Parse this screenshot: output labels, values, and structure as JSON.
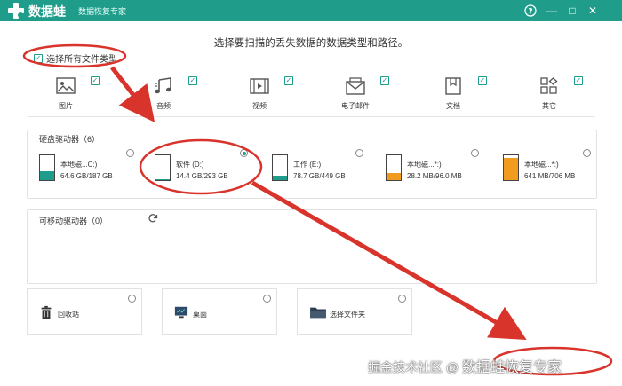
{
  "app": {
    "name": "数据蛙",
    "subtitle": "数据恢复专家"
  },
  "window_buttons": {
    "help": "?",
    "minimize": "—",
    "maximize": "□",
    "close": "✕"
  },
  "instruction": "选择要扫描的丢失数据的数据类型和路径。",
  "select_all_label": "选择所有文件类型",
  "file_types": [
    {
      "label": "图片",
      "icon": "image-icon",
      "checked": true
    },
    {
      "label": "音频",
      "icon": "music-icon",
      "checked": true
    },
    {
      "label": "视频",
      "icon": "video-icon",
      "checked": true
    },
    {
      "label": "电子邮件",
      "icon": "email-icon",
      "checked": true
    },
    {
      "label": "文档",
      "icon": "document-icon",
      "checked": true
    },
    {
      "label": "其它",
      "icon": "other-icon",
      "checked": true
    }
  ],
  "hard_drives": {
    "title": "硬盘驱动器（6）",
    "items": [
      {
        "name": "本地磁...C:)",
        "size": "64.6 GB/187 GB",
        "fill_color": "#1f9d8a",
        "fill_fraction": 0.35,
        "selected": false
      },
      {
        "name": "软件 (D:)",
        "size": "14.4 GB/293 GB",
        "fill_color": "#1f9d8a",
        "fill_fraction": 0.05,
        "selected": true
      },
      {
        "name": "工作 (E:)",
        "size": "78.7 GB/449 GB",
        "fill_color": "#1f9d8a",
        "fill_fraction": 0.18,
        "selected": false
      },
      {
        "name": "本地磁...*:)",
        "size": "28.2 MB/96.0 MB",
        "fill_color": "#f29c1f",
        "fill_fraction": 0.29,
        "selected": false
      },
      {
        "name": "本地磁...*:)",
        "size": "641 MB/706 MB",
        "fill_color": "#f29c1f",
        "fill_fraction": 0.91,
        "selected": false
      }
    ]
  },
  "removable_drives": {
    "title": "可移动驱动器（0）",
    "refresh_icon": "refresh-icon"
  },
  "locations": [
    {
      "label": "回收站",
      "icon": "trash-icon"
    },
    {
      "label": "桌面",
      "icon": "desktop-icon"
    },
    {
      "label": "选择文件夹",
      "icon": "folder-icon"
    }
  ],
  "watermark": {
    "prefix": "掘金技术社区 @",
    "brand": "数据蛙恢复专家"
  },
  "colors": {
    "accent": "#1f9d8a",
    "annotation": "#d9342b",
    "warning": "#f29c1f"
  }
}
